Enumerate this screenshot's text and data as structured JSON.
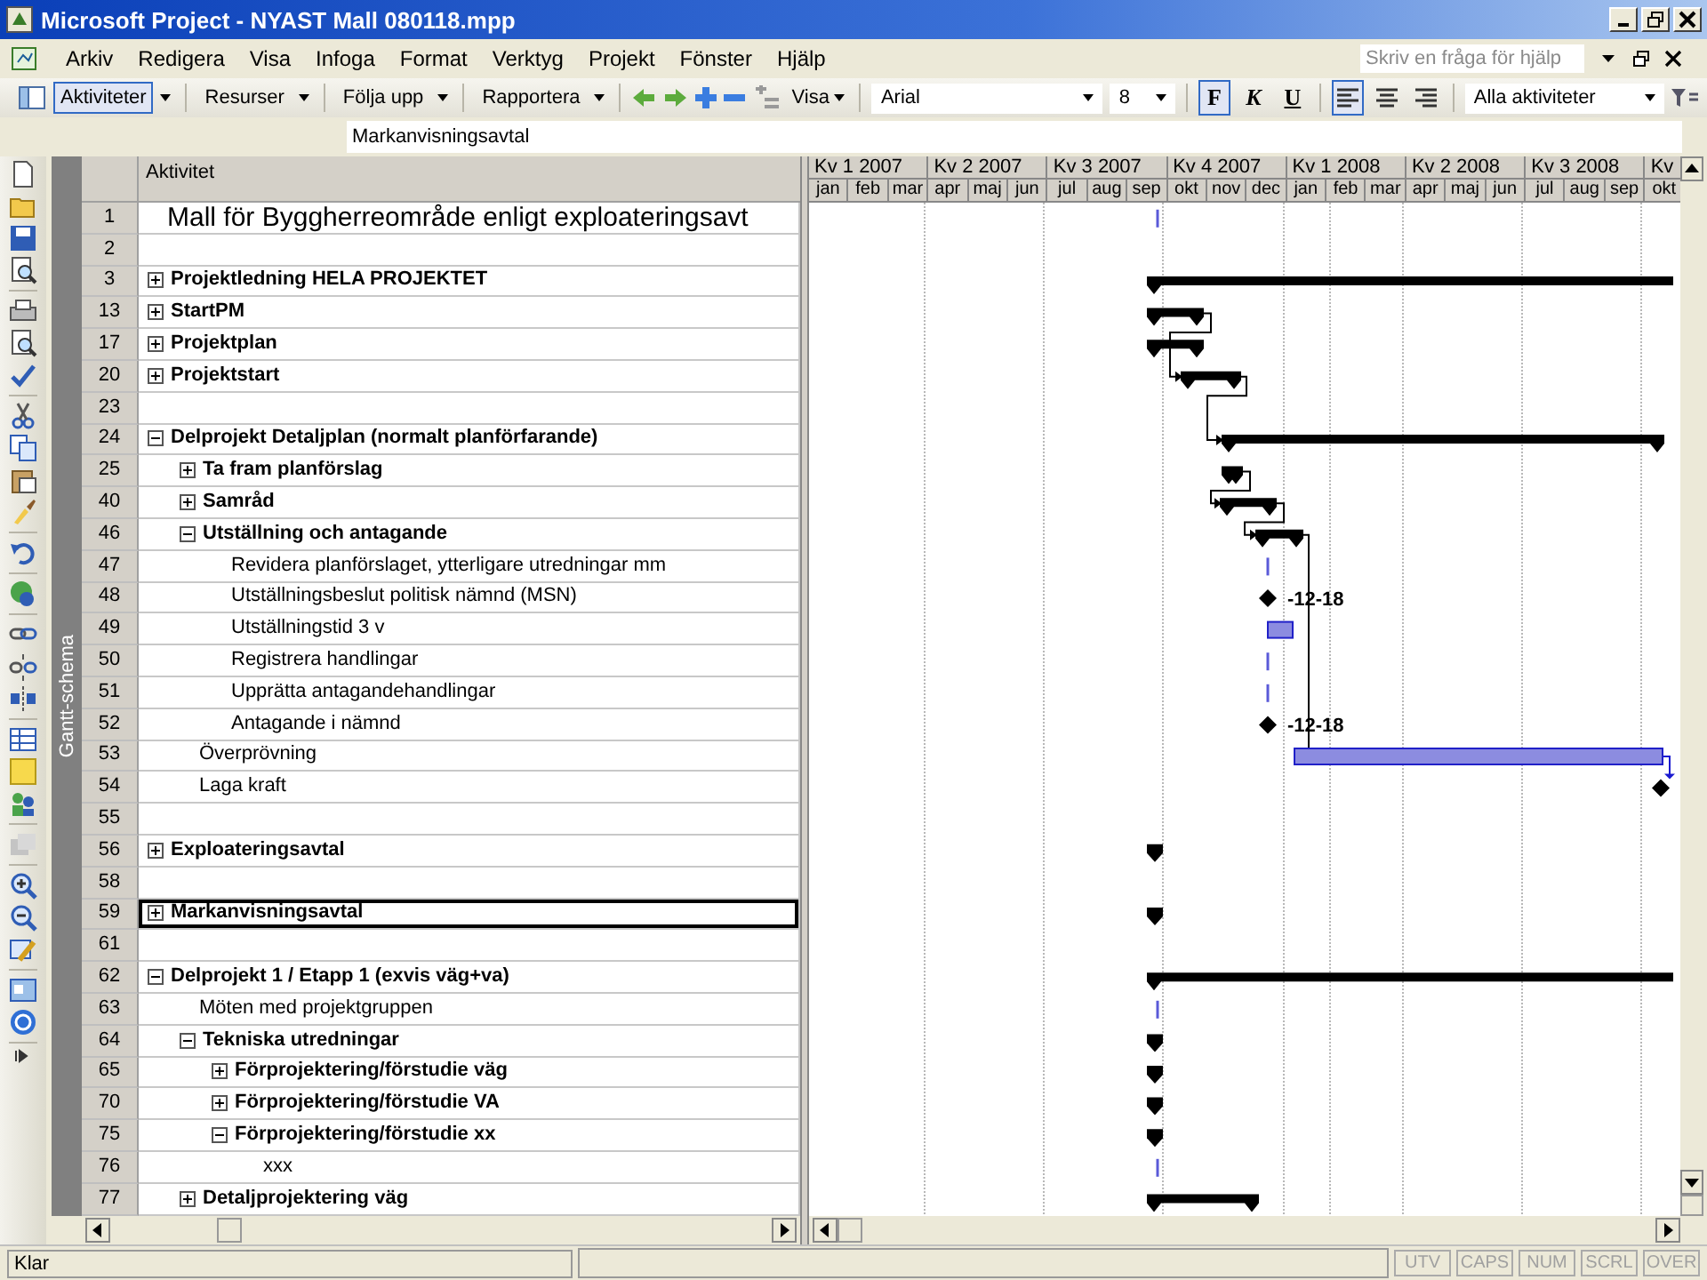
{
  "window": {
    "title": "Microsoft Project - NYAST Mall 080118.mpp"
  },
  "menu": [
    "Arkiv",
    "Redigera",
    "Visa",
    "Infoga",
    "Format",
    "Verktyg",
    "Projekt",
    "Fönster",
    "Hjälp"
  ],
  "help_search": {
    "placeholder": "Skriv en fråga för hjälp"
  },
  "toolbar": {
    "guide_buttons": [
      {
        "label": "Aktiviteter",
        "selected": true
      },
      {
        "label": "Resurser",
        "selected": false
      },
      {
        "label": "Följa upp",
        "selected": false
      },
      {
        "label": "Rapportera",
        "selected": false
      }
    ],
    "show_menu": "Visa",
    "font": "Arial",
    "font_size": "8",
    "format_buttons": [
      {
        "label": "F",
        "selected": true
      },
      {
        "label": "K",
        "selected": false
      },
      {
        "label": "U",
        "selected": false
      }
    ],
    "alignment": [
      {
        "kind": "left",
        "selected": true
      },
      {
        "kind": "center",
        "selected": false
      },
      {
        "kind": "right",
        "selected": false
      }
    ],
    "filter": "Alla aktiviteter"
  },
  "entry_bar": {
    "value": "Markanvisningsavtal"
  },
  "view_bar": {
    "label": "Gantt-schema"
  },
  "table": {
    "column": "Aktivitet",
    "rows": [
      {
        "number": "1",
        "kind": "title",
        "name": "Mall för Byggherreområde enligt exploateringsavt",
        "selected": false
      },
      {
        "number": "2",
        "kind": "blank",
        "selected": false
      },
      {
        "number": "3",
        "kind": "summary",
        "name": "Projektledning HELA PROJEKTET",
        "expanded": false,
        "selected": false
      },
      {
        "number": "13",
        "kind": "summary",
        "name": "StartPM",
        "expanded": false,
        "selected": false
      },
      {
        "number": "17",
        "kind": "summary",
        "name": "Projektplan",
        "expanded": false,
        "selected": false
      },
      {
        "number": "20",
        "kind": "summary",
        "name": "Projektstart",
        "expanded": false,
        "selected": false
      },
      {
        "number": "23",
        "kind": "blank",
        "selected": false
      },
      {
        "number": "24",
        "kind": "summary",
        "name": "Delprojekt Detaljplan (normalt planförfarande)",
        "expanded": true,
        "selected": false,
        "children": [
          {
            "number": "25",
            "kind": "summary",
            "name": "Ta fram planförslag",
            "expanded": false,
            "selected": false
          },
          {
            "number": "40",
            "kind": "summary",
            "name": "Samråd",
            "expanded": false,
            "selected": false
          },
          {
            "number": "46",
            "kind": "summary",
            "name": "Utställning och antagande",
            "expanded": true,
            "selected": false,
            "children": [
              {
                "number": "47",
                "kind": "task",
                "name": "Revidera planförslaget, ytterligare utredningar mm",
                "selected": false
              },
              {
                "number": "48",
                "kind": "task",
                "name": "Utställningsbeslut politisk nämnd (MSN)",
                "selected": false
              },
              {
                "number": "49",
                "kind": "task",
                "name": "Utställningstid 3 v",
                "selected": false
              },
              {
                "number": "50",
                "kind": "task",
                "name": "Registrera handlingar",
                "selected": false
              },
              {
                "number": "51",
                "kind": "task",
                "name": "Upprätta antagandehandlingar",
                "selected": false
              },
              {
                "number": "52",
                "kind": "task",
                "name": "Antagande i nämnd",
                "selected": false
              }
            ]
          },
          {
            "number": "53",
            "kind": "task",
            "name": "Överprövning",
            "selected": false
          },
          {
            "number": "54",
            "kind": "task",
            "name": "Laga kraft",
            "selected": false
          }
        ]
      },
      {
        "number": "55",
        "kind": "blank",
        "selected": false
      },
      {
        "number": "56",
        "kind": "summary",
        "name": "Exploateringsavtal",
        "expanded": false,
        "selected": false
      },
      {
        "number": "58",
        "kind": "blank",
        "selected": false
      },
      {
        "number": "59",
        "kind": "summary",
        "name": "Markanvisningsavtal",
        "expanded": false,
        "selected": true
      },
      {
        "number": "61",
        "kind": "blank",
        "selected": false
      },
      {
        "number": "62",
        "kind": "summary",
        "name": "Delprojekt 1 / Etapp 1 (exvis väg+va)",
        "expanded": true,
        "selected": false,
        "children": [
          {
            "number": "63",
            "kind": "task",
            "name": "Möten med projektgruppen",
            "selected": false
          },
          {
            "number": "64",
            "kind": "summary",
            "name": "Tekniska utredningar",
            "expanded": true,
            "selected": false,
            "children": [
              {
                "number": "65",
                "kind": "summary",
                "name": "Förprojektering/förstudie väg",
                "expanded": false,
                "selected": false
              },
              {
                "number": "70",
                "kind": "summary",
                "name": "Förprojektering/förstudie VA",
                "expanded": false,
                "selected": false
              },
              {
                "number": "75",
                "kind": "summary",
                "name": "Förprojektering/förstudie xx",
                "expanded": true,
                "selected": false,
                "children": [
                  {
                    "number": "76",
                    "kind": "task",
                    "name": "xxx",
                    "selected": false
                  }
                ]
              }
            ]
          },
          {
            "number": "77",
            "kind": "summary",
            "name": "Detaljprojektering väg",
            "expanded": false,
            "selected": false
          }
        ]
      }
    ]
  },
  "timescale": {
    "quarters": [
      "Kv 1 2007",
      "Kv 2 2007",
      "Kv 3 2007",
      "Kv 4 2007",
      "Kv 1 2008",
      "Kv 2 2008",
      "Kv 3 2008",
      "Kv"
    ],
    "months": [
      "jan",
      "feb",
      "mar",
      "apr",
      "maj",
      "jun",
      "jul",
      "aug",
      "sep",
      "okt",
      "nov",
      "dec",
      "jan",
      "feb",
      "mar",
      "apr",
      "maj",
      "jun",
      "jul",
      "aug",
      "sep",
      "okt"
    ]
  },
  "gantt": {
    "milestone_labels": [
      "-12-18",
      "-12-18"
    ]
  },
  "status_bar": {
    "text": "Klar",
    "indicators": [
      {
        "label": "UTV",
        "on": false
      },
      {
        "label": "CAPS",
        "on": false
      },
      {
        "label": "NUM",
        "on": false
      },
      {
        "label": "SCRL",
        "on": false
      },
      {
        "label": "OVER",
        "on": false
      }
    ]
  }
}
